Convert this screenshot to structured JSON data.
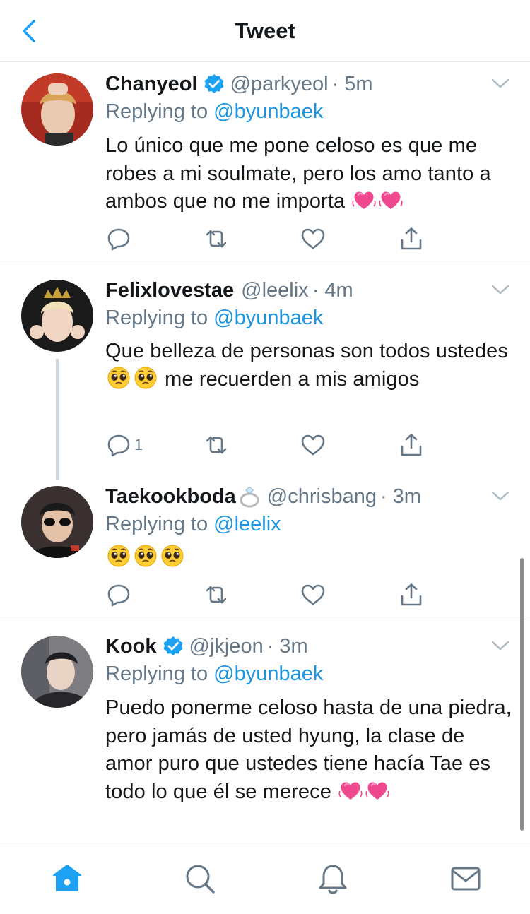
{
  "header": {
    "title": "Tweet"
  },
  "colors": {
    "brand": "#1da1f2",
    "mention": "#1b95e0",
    "secondary": "#657786",
    "heart_emoji": "#f0488f"
  },
  "tweets": [
    {
      "name": "Chanyeol",
      "verified": true,
      "handle": "@parkyeol",
      "time": "· 5m",
      "replying_prefix": "Replying to",
      "replying_to": "@byunbaek",
      "text": "Lo único que me pone celoso es que me robes a mi soulmate, pero los amo tanto a ambos que no me importa",
      "emojis": [
        "growing-heart",
        "growing-heart"
      ]
    },
    {
      "name": "Felixlovestae",
      "verified": false,
      "handle": "@leelix",
      "time": "· 4m",
      "replying_prefix": "Replying to",
      "replying_to": "@byunbaek",
      "text_a": "Que belleza de personas son todos ustedes",
      "text_b": "me recuerden a mis amigos",
      "emojis": [
        "pleading-face",
        "pleading-face"
      ],
      "reply_count": "1"
    },
    {
      "name": "Taekookboda",
      "name_emoji": "ring",
      "verified": false,
      "handle": "@chrisbang",
      "time": "· 3m",
      "replying_prefix": "Replying to",
      "replying_to": "@leelix",
      "emojis": [
        "pleading-face",
        "pleading-face",
        "pleading-face"
      ]
    },
    {
      "name": "Kook",
      "verified": true,
      "handle": "@jkjeon",
      "time": "· 3m",
      "replying_prefix": "Replying to",
      "replying_to": "@byunbaek",
      "text": "Puedo ponerme celoso hasta de una piedra, pero jamás de usted hyung, la clase de amor puro que ustedes tiene hacía Tae es todo lo que él se merece",
      "emojis": [
        "growing-heart",
        "growing-heart"
      ]
    }
  ],
  "tabbar": [
    "home-icon",
    "search-icon",
    "notifications-icon",
    "messages-icon"
  ]
}
